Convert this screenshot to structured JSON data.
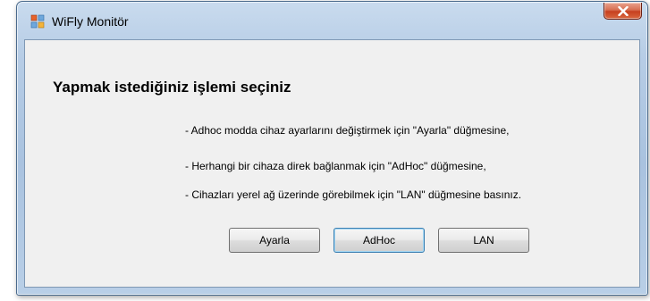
{
  "window": {
    "title": "WiFly Monitör"
  },
  "dialog": {
    "heading": "Yapmak istediğiniz işlemi seçiniz",
    "instructions": [
      "- Adhoc modda cihaz ayarlarını değiştirmek için \"Ayarla\" düğmesine,",
      "- Herhangi bir cihaza direk bağlanmak için \"AdHoc\" düğmesine,",
      "- Cihazları yerel ağ üzerinde görebilmek için \"LAN\" düğmesine basınız."
    ],
    "buttons": {
      "ayarla": "Ayarla",
      "adhoc": "AdHoc",
      "lan": "LAN"
    },
    "focused_button": "AdHoc"
  },
  "icons": {
    "app": "app-window-icon",
    "close": "close-icon"
  },
  "colors": {
    "frame": "#b7cde6",
    "client": "#f0f0f0",
    "close_button": "#c7401f",
    "focus_border": "#3c7fb1"
  }
}
